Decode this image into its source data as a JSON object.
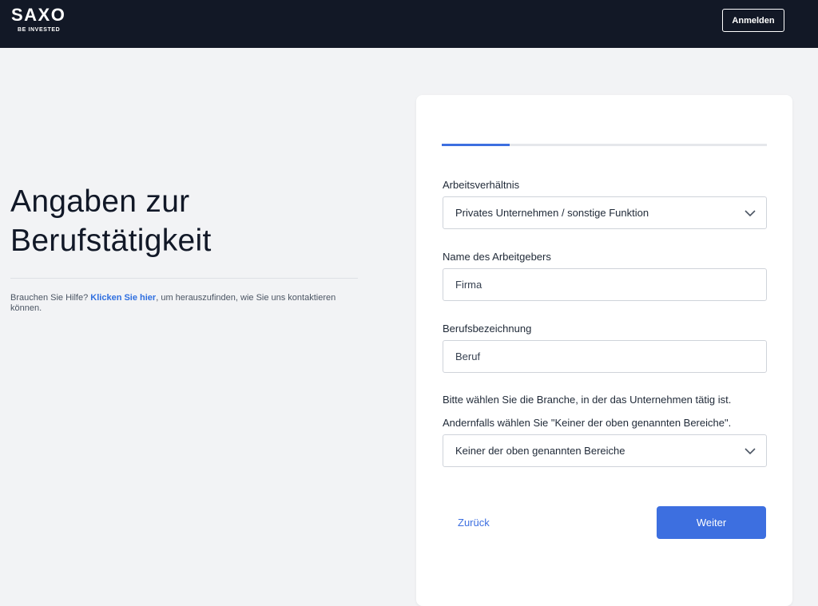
{
  "header": {
    "logo_text": "SAXO",
    "logo_tagline": "BE INVESTED",
    "login_label": "Anmelden"
  },
  "intro": {
    "title_line1": "Angaben zur",
    "title_line2": "Berufstätigkeit",
    "help_prefix": "Brauchen Sie Hilfe? ",
    "help_link": "Klicken Sie hier",
    "help_suffix": ", um herauszufinden, wie Sie uns kontaktieren können."
  },
  "form": {
    "progress": 0.21,
    "employment_status": {
      "label": "Arbeitsverhältnis",
      "value": "Privates Unternehmen / sonstige Funktion"
    },
    "employer_name": {
      "label": "Name des Arbeitgebers",
      "placeholder": "Firma"
    },
    "job_title": {
      "label": "Berufsbezeichnung",
      "placeholder": "Beruf"
    },
    "industry": {
      "note_line1": "Bitte wählen Sie die Branche, in der das Unternehmen tätig ist.",
      "note_line2": "Andernfalls wählen Sie \"Keiner der oben genannten Bereiche\".",
      "value": "Keiner der oben genannten Bereiche"
    },
    "back_label": "Zurück",
    "next_label": "Weiter"
  },
  "colors": {
    "topbar": "#121826",
    "accent": "#3d6fe0",
    "link": "#2f6fe0",
    "background": "#f2f3f5"
  },
  "icons": {
    "dropdown": "chevron-down-icon"
  }
}
